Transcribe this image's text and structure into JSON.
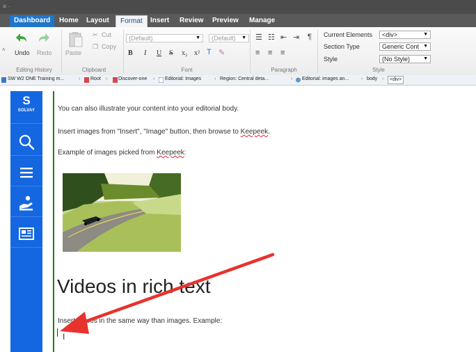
{
  "ribbon": {
    "tabs": [
      {
        "label": "Dashboard"
      },
      {
        "label": "Home"
      },
      {
        "label": "Layout"
      },
      {
        "label": "Format"
      },
      {
        "label": "Insert"
      },
      {
        "label": "Review"
      },
      {
        "label": "Preview"
      },
      {
        "label": "Manage"
      }
    ],
    "editing_history": {
      "undo": "Undo",
      "redo": "Redo",
      "label": "Editing History"
    },
    "clipboard": {
      "cut": "Cut",
      "copy": "Copy",
      "paste": "Paste",
      "label": "Clipboard"
    },
    "font": {
      "family": "(Default)",
      "size": "(Default)",
      "label": "Font",
      "buttons": {
        "bold": "B",
        "italic": "I",
        "underline": "U",
        "strike": "S",
        "sub": "x₂",
        "sup": "x²"
      }
    },
    "paragraph": {
      "label": "Paragraph"
    },
    "style": {
      "label": "Style",
      "current_elements_label": "Current Elements",
      "current_elements_value": "<div>",
      "section_type_label": "Section Type",
      "section_type_value": "Generic Cont",
      "style_label": "Style",
      "style_value": "(No Style)"
    }
  },
  "breadcrumb": [
    "SW W2 ONE Training m...",
    "Root",
    "Discover-one",
    "Editorial: Images",
    "Region: Central deta...",
    "Editorial: images an...",
    "body",
    "<div>"
  ],
  "nav": {
    "logo": "S",
    "logo_text": "SOLVAY"
  },
  "content": {
    "p1": "You can also illustrate your content into your editorial body.",
    "p2_pre": "Insert images from \"Insert\", \"Image\" button, then browse to ",
    "p2_link": "Keepeek",
    "p2_post": ".",
    "p3_pre": "Example of images picked from ",
    "p3_link": "Keepeek",
    "p3_post": ":",
    "heading": "Videos in rich text",
    "p4": "Insert videos in the same way than images. Example:"
  },
  "colors": {
    "accent": "#1467e0",
    "annotation_arrow": "#e8322e",
    "tab_blue": "#1f76c8"
  }
}
